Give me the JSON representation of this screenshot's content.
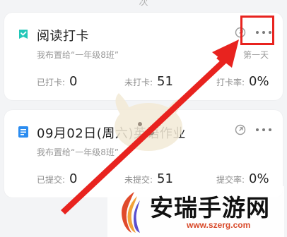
{
  "top_partial_text": "次",
  "cards": [
    {
      "title": "阅读打卡",
      "subtitle": "我布置给“一年级8班”",
      "extra": "第一天",
      "stats": [
        {
          "label": "已打卡:",
          "value": "0"
        },
        {
          "label": "未打卡:",
          "value": "51"
        },
        {
          "label": "打卡率:",
          "value": "0%"
        }
      ],
      "icon": "checkin-icon"
    },
    {
      "title": "09月02日(周六)英语作业",
      "subtitle": "我布置给“一年级8班”",
      "stats": [
        {
          "label": "已提交:",
          "value": "0"
        },
        {
          "label": "未提交:",
          "value": "51"
        },
        {
          "label": "提交率:",
          "value": "0%"
        }
      ],
      "icon": "homework-icon"
    }
  ],
  "watermark": {
    "name": "安瑞手游网",
    "url": "www.szerg.com"
  },
  "colors": {
    "highlight": "#e8231f",
    "checkin_icon": "#22c7b8",
    "homework_icon": "#2b8cf0",
    "watermark_url": "#d84a2a"
  }
}
